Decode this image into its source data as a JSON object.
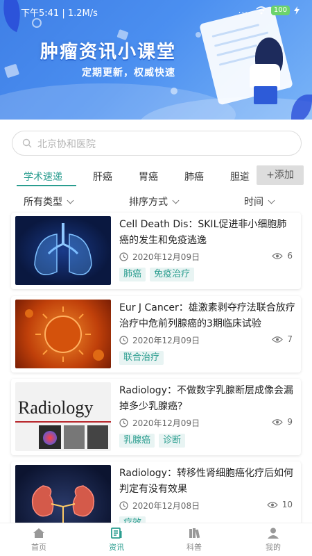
{
  "status_bar": {
    "time": "下午5:41 | 1.2M/s",
    "signal": "....",
    "battery": "100"
  },
  "banner": {
    "title": "肿瘤资讯小课堂",
    "subtitle": "定期更新，权威快速"
  },
  "search": {
    "placeholder": "北京协和医院"
  },
  "tabs": {
    "items": [
      "学术速递",
      "肝癌",
      "胃癌",
      "肺癌",
      "胆道"
    ],
    "active": "学术速递",
    "add_label": "+添加"
  },
  "filters": {
    "type": "所有类型",
    "sort": "排序方式",
    "time": "时间"
  },
  "articles": [
    {
      "title": "Cell Death Dis：SKIL促进非小细胞肺癌的发生和免疫逃逸",
      "date": "2020年12月09日",
      "views": "6",
      "tags": [
        "肺癌",
        "免疫治疗"
      ]
    },
    {
      "title": "Eur J Cancer：雄激素剥夺疗法联合放疗治疗中危前列腺癌的3期临床试验",
      "date": "2020年12月09日",
      "views": "7",
      "tags": [
        "联合治疗"
      ]
    },
    {
      "title": "Radiology：不做数字乳腺断层成像会漏掉多少乳腺癌?",
      "date": "2020年12月09日",
      "views": "9",
      "tags": [
        "乳腺癌",
        "诊断"
      ],
      "thumb_text": "Radiology"
    },
    {
      "title": "Radiology：转移性肾细胞癌化疗后如何判定有没有效果",
      "date": "2020年12月08日",
      "views": "10",
      "tags": [
        "疗效"
      ]
    }
  ],
  "bottom_nav": {
    "items": [
      "首页",
      "资讯",
      "科普",
      "我的"
    ],
    "active": "资讯"
  },
  "colors": {
    "accent": "#2a9d8f",
    "banner": "#4b8ff0",
    "tag_bg": "#e8f4f3"
  }
}
